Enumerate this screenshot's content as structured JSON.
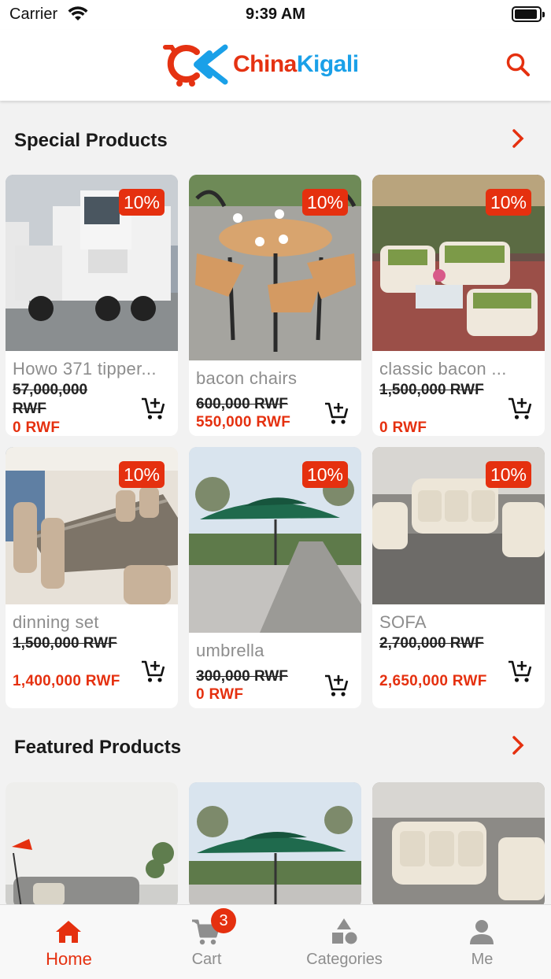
{
  "status_bar": {
    "carrier": "Carrier",
    "time": "9:39 AM"
  },
  "header": {
    "brand_part1": "China",
    "brand_part2": "Kigali",
    "brand_color_red": "#e53212",
    "brand_color_blue": "#1aa0e8"
  },
  "accent_color": "#e5300f",
  "special": {
    "title": "Special Products",
    "products": [
      {
        "name": "Howo 371 tipper...",
        "discount": "10%",
        "old_price": "57,000,000 RWF",
        "new_price": "0 RWF"
      },
      {
        "name": "bacon chairs",
        "discount": "10%",
        "old_price": "600,000 RWF",
        "new_price": "550,000 RWF"
      },
      {
        "name": "classic bacon ...",
        "discount": "10%",
        "old_price": "1,500,000 RWF",
        "new_price": "0 RWF"
      },
      {
        "name": "dinning set",
        "discount": "10%",
        "old_price": "1,500,000 RWF",
        "new_price": "1,400,000 RWF"
      },
      {
        "name": "umbrella",
        "discount": "10%",
        "old_price": "300,000 RWF",
        "new_price": "0 RWF"
      },
      {
        "name": "SOFA",
        "discount": "10%",
        "old_price": "2,700,000 RWF",
        "new_price": "2,650,000 RWF"
      }
    ]
  },
  "featured": {
    "title": "Featured Products"
  },
  "tabbar": {
    "cart_count": "3",
    "tabs": [
      {
        "label": "Home",
        "icon": "home-icon",
        "active": true
      },
      {
        "label": "Cart",
        "icon": "cart-icon",
        "active": false
      },
      {
        "label": "Categories",
        "icon": "categories-icon",
        "active": false
      },
      {
        "label": "Me",
        "icon": "person-icon",
        "active": false
      }
    ]
  }
}
